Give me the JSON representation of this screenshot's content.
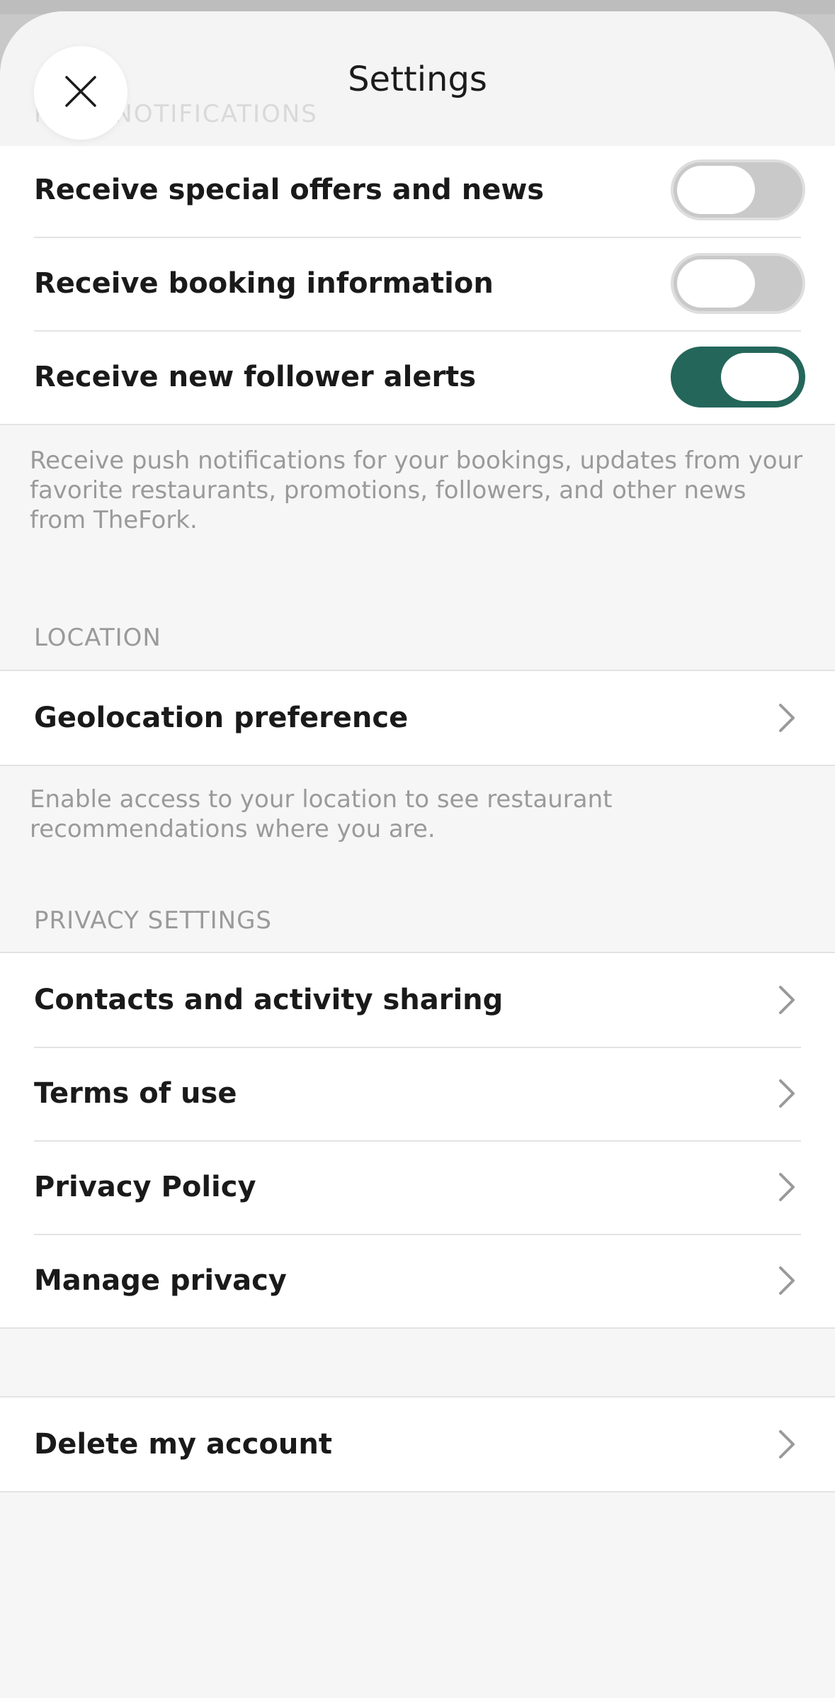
{
  "header": {
    "title": "Settings",
    "ghost_heading": "PUSH NOTIFICATIONS",
    "close_icon": "close-icon"
  },
  "notifications": {
    "items": [
      {
        "label": "Receive special offers and news",
        "enabled": false
      },
      {
        "label": "Receive booking information",
        "enabled": false
      },
      {
        "label": "Receive new follower alerts",
        "enabled": true
      }
    ],
    "note": "Receive push notifications for your bookings, updates from your favorite restaurants, promotions, followers, and other news from TheFork."
  },
  "location": {
    "heading": "LOCATION",
    "items": [
      {
        "label": "Geolocation preference",
        "icon": "chevron-right-icon"
      }
    ],
    "note": "Enable access to your location to see restaurant recommendations where you are."
  },
  "privacy": {
    "heading": "PRIVACY SETTINGS",
    "items": [
      {
        "label": "Contacts and activity sharing",
        "icon": "chevron-right-icon"
      },
      {
        "label": "Terms of use",
        "icon": "chevron-right-icon"
      },
      {
        "label": "Privacy Policy",
        "icon": "chevron-right-icon"
      },
      {
        "label": "Manage privacy",
        "icon": "chevron-right-icon"
      }
    ]
  },
  "account": {
    "items": [
      {
        "label": "Delete my account",
        "icon": "chevron-right-icon"
      }
    ]
  },
  "colors": {
    "toggle_on": "#24665a",
    "toggle_off": "#c9c9c9",
    "background": "#f6f6f6"
  }
}
